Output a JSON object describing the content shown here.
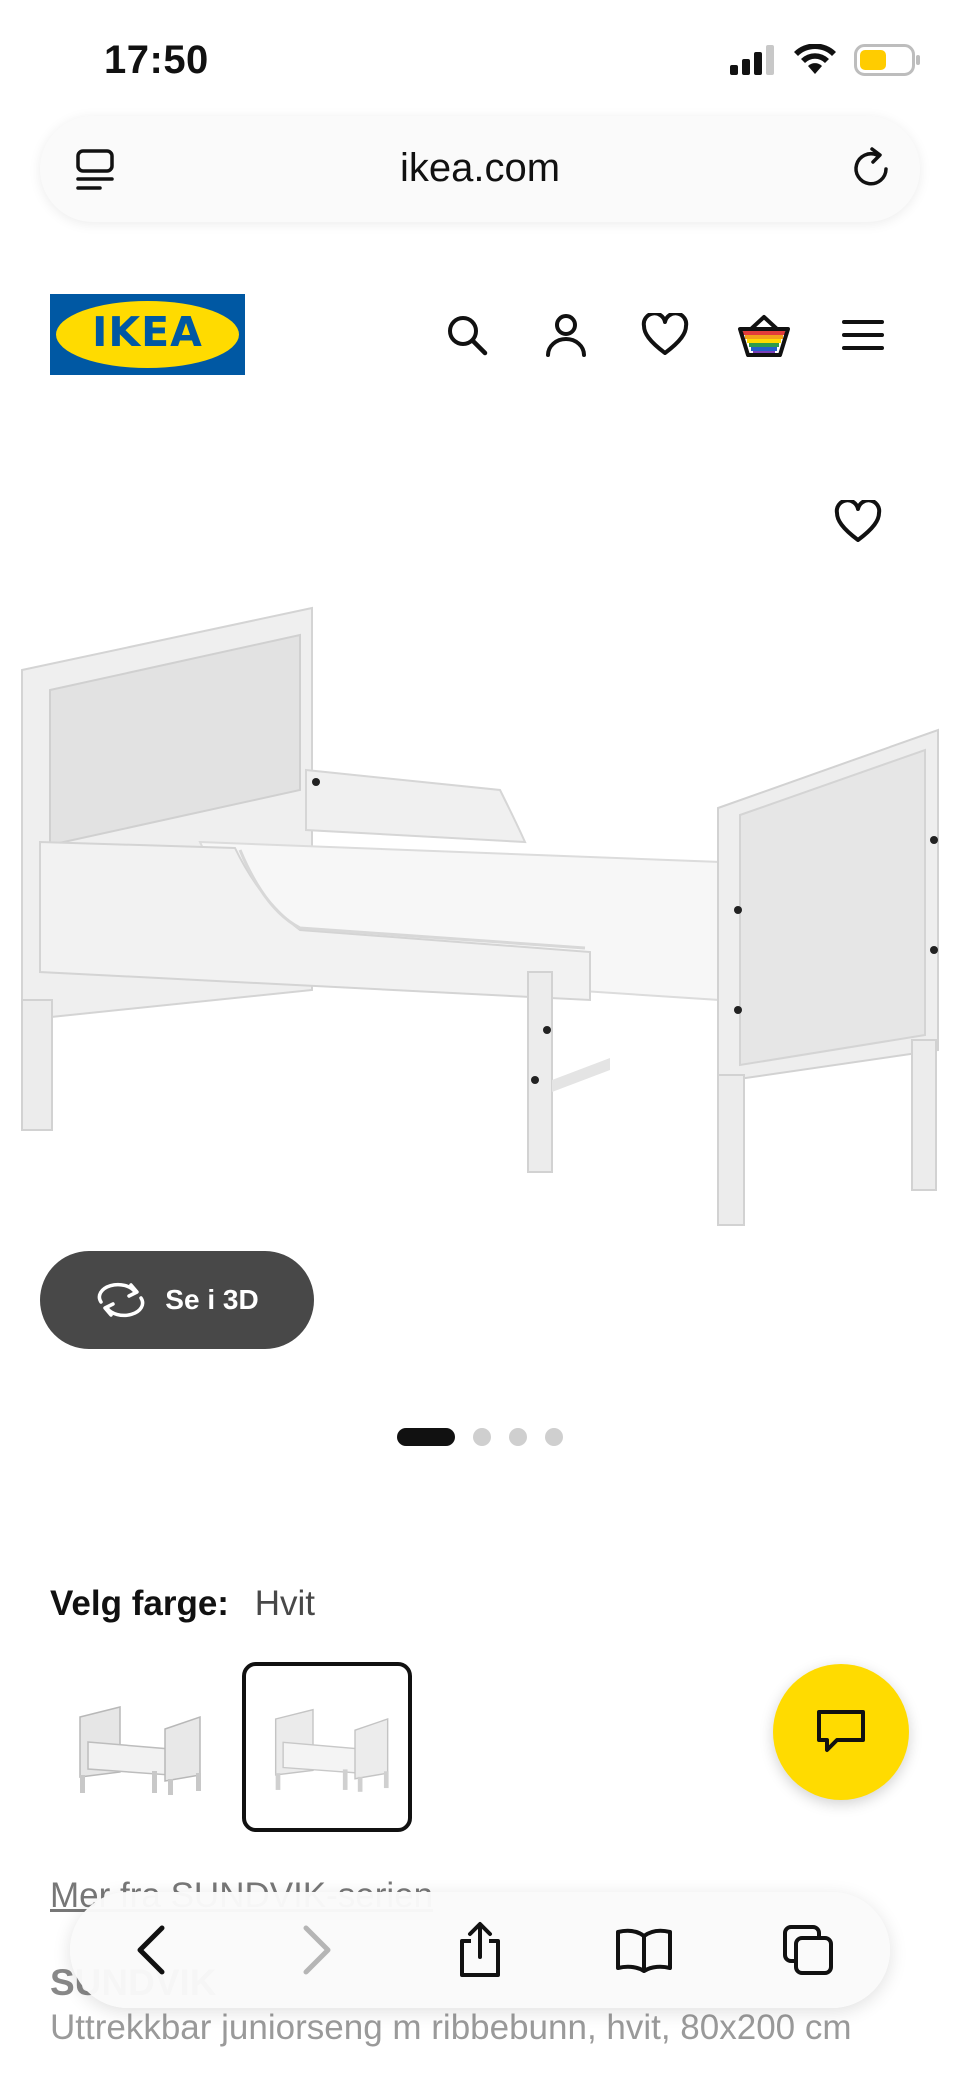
{
  "status": {
    "time": "17:50"
  },
  "browser": {
    "url": "ikea.com"
  },
  "brand": {
    "logo_text": "IKEA",
    "primary": "#0058a3",
    "accent": "#ffdb00"
  },
  "header": {
    "icons": [
      "search-icon",
      "account-icon",
      "heart-icon",
      "basket-icon",
      "menu-icon"
    ]
  },
  "gallery": {
    "view_3d_label": "Se i 3D",
    "slide_count": 4,
    "active_slide": 1
  },
  "color_picker": {
    "label": "Velg farge:",
    "selected": "Hvit",
    "swatch_count": 2,
    "selected_index": 1
  },
  "product": {
    "more_link": "Mer fra SUNDVIK-serien",
    "name": "SUNDVIK",
    "description": "Uttrekkbar juniorseng m ribbebunn, hvit, 80x200 cm"
  },
  "toolbar": {
    "icons": [
      "back-icon",
      "forward-icon",
      "share-icon",
      "bookmarks-icon",
      "tabs-icon"
    ]
  }
}
